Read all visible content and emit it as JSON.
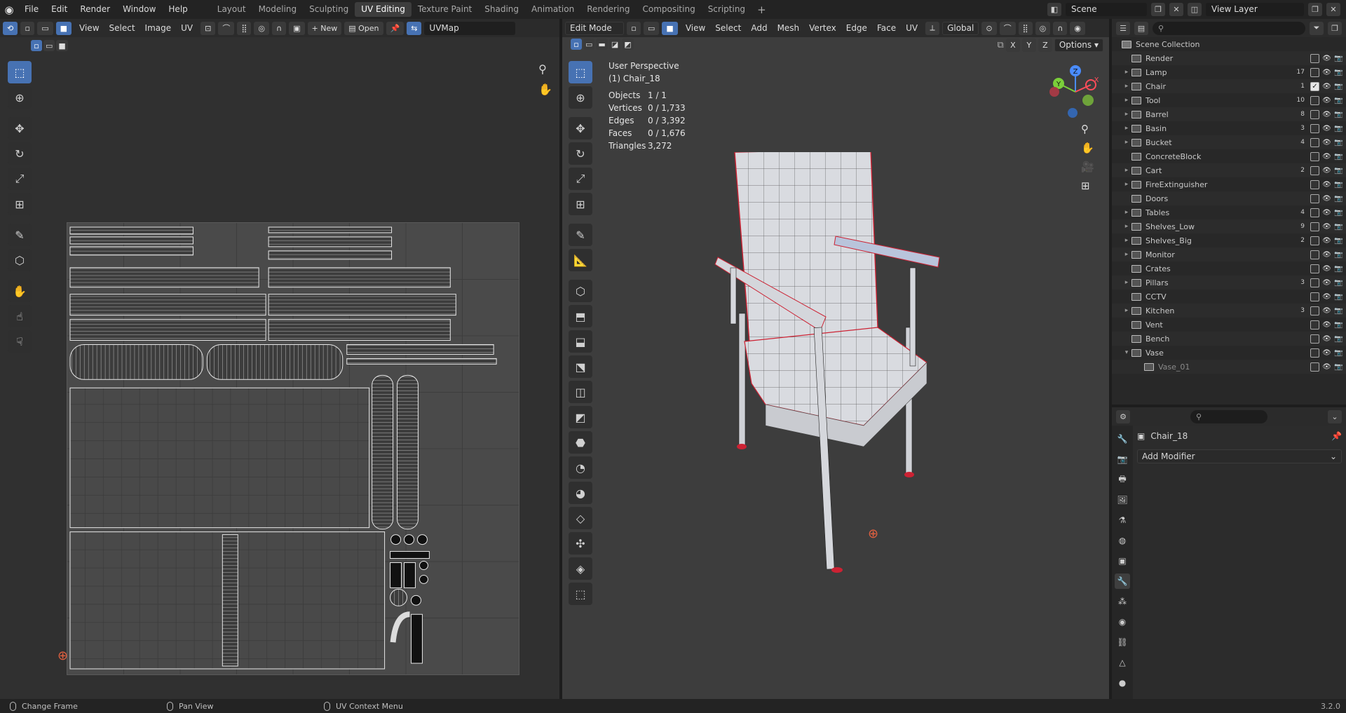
{
  "topbar": {
    "menus": [
      "File",
      "Edit",
      "Render",
      "Window",
      "Help"
    ],
    "workspaces": [
      "Layout",
      "Modeling",
      "Sculpting",
      "UV Editing",
      "Texture Paint",
      "Shading",
      "Animation",
      "Rendering",
      "Compositing",
      "Scripting"
    ],
    "active_workspace": "UV Editing",
    "scene": "Scene",
    "view_layer": "View Layer"
  },
  "uv_editor": {
    "menus": [
      "View",
      "Select",
      "Image",
      "UV"
    ],
    "new_label": "New",
    "open_label": "Open",
    "uv_map": "UVMap"
  },
  "viewport": {
    "mode": "Edit Mode",
    "menus": [
      "View",
      "Select",
      "Add",
      "Mesh",
      "Vertex",
      "Edge",
      "Face",
      "UV"
    ],
    "transform_orientation": "Global",
    "axes": [
      "X",
      "Y",
      "Z"
    ],
    "options_label": "Options",
    "perspective": "User Perspective",
    "object_label": "(1) Chair_18",
    "stats": [
      {
        "k": "Objects",
        "v": "1 / 1"
      },
      {
        "k": "Vertices",
        "v": "0 / 1,733"
      },
      {
        "k": "Edges",
        "v": "0 / 3,392"
      },
      {
        "k": "Faces",
        "v": "0 / 1,676"
      },
      {
        "k": "Triangles",
        "v": "3,272"
      }
    ],
    "gizmo_labels": {
      "z": "Z",
      "y": "Y",
      "x": "X"
    }
  },
  "outliner": {
    "root": "Scene Collection",
    "items": [
      {
        "name": "Render",
        "badge": "",
        "expand": ""
      },
      {
        "name": "Lamp",
        "badge": "17",
        "expand": "▸"
      },
      {
        "name": "Chair",
        "badge": "1",
        "expand": "▸",
        "active": true
      },
      {
        "name": "Tool",
        "badge": "10",
        "expand": "▸"
      },
      {
        "name": "Barrel",
        "badge": "8",
        "expand": "▸"
      },
      {
        "name": "Basin",
        "badge": "3",
        "expand": "▸"
      },
      {
        "name": "Bucket",
        "badge": "4",
        "expand": "▸"
      },
      {
        "name": "ConcreteBlock",
        "badge": "",
        "expand": ""
      },
      {
        "name": "Cart",
        "badge": "2",
        "expand": "▸"
      },
      {
        "name": "FireExtinguisher",
        "badge": "",
        "expand": "▸"
      },
      {
        "name": "Doors",
        "badge": "",
        "expand": ""
      },
      {
        "name": "Tables",
        "badge": "4",
        "expand": "▸"
      },
      {
        "name": "Shelves_Low",
        "badge": "9",
        "expand": "▸"
      },
      {
        "name": "Shelves_Big",
        "badge": "2",
        "expand": "▸"
      },
      {
        "name": "Monitor",
        "badge": "",
        "expand": "▸"
      },
      {
        "name": "Crates",
        "badge": "",
        "expand": ""
      },
      {
        "name": "Pillars",
        "badge": "3",
        "expand": "▸"
      },
      {
        "name": "CCTV",
        "badge": "",
        "expand": ""
      },
      {
        "name": "Kitchen",
        "badge": "3",
        "expand": "▸"
      },
      {
        "name": "Vent",
        "badge": "",
        "expand": ""
      },
      {
        "name": "Bench",
        "badge": "",
        "expand": ""
      },
      {
        "name": "Vase",
        "badge": "",
        "expand": "▾"
      },
      {
        "name": "Vase_01",
        "badge": "",
        "expand": "",
        "child": true
      }
    ]
  },
  "properties": {
    "object_name": "Chair_18",
    "add_modifier": "Add Modifier"
  },
  "statusbar": {
    "items": [
      "Change Frame",
      "Pan View",
      "UV Context Menu"
    ],
    "version": "3.2.0"
  }
}
